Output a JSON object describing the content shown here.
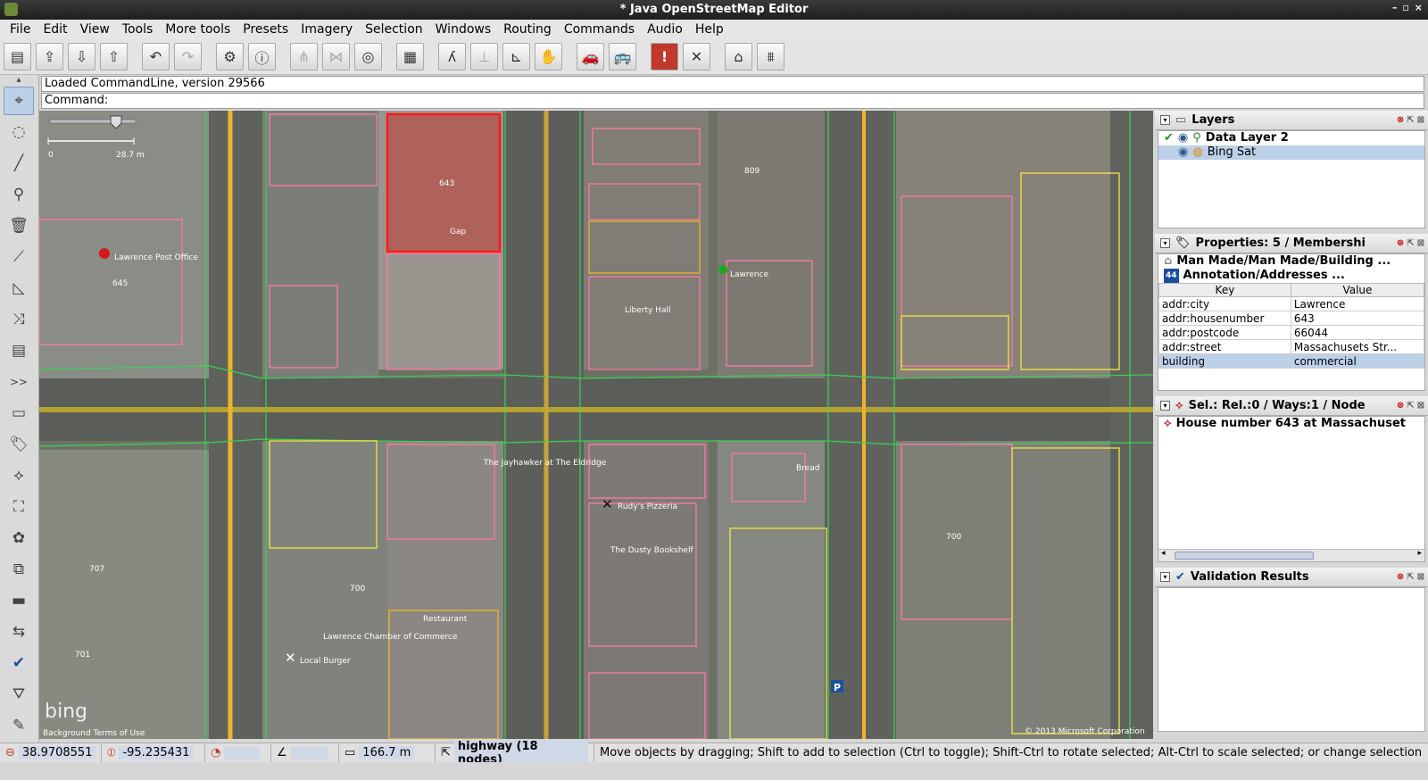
{
  "window": {
    "title": "* Java OpenStreetMap Editor",
    "controls": [
      "–",
      "▫",
      "×"
    ]
  },
  "menu": [
    "File",
    "Edit",
    "View",
    "Tools",
    "More tools",
    "Presets",
    "Imagery",
    "Selection",
    "Windows",
    "Routing",
    "Commands",
    "Audio",
    "Help"
  ],
  "toolbar": {
    "buttons": [
      {
        "name": "open-file",
        "glyph": "▤"
      },
      {
        "name": "save",
        "glyph": "⇪"
      },
      {
        "name": "download",
        "glyph": "⇩"
      },
      {
        "name": "upload",
        "glyph": "⇧"
      },
      {
        "name": "undo",
        "glyph": "↶"
      },
      {
        "name": "redo",
        "glyph": "↷"
      },
      {
        "name": "preferences",
        "glyph": "⚙"
      },
      {
        "name": "info",
        "glyph": "ⓘ"
      },
      {
        "name": "split-way",
        "glyph": "⋔"
      },
      {
        "name": "combine-way",
        "glyph": "⋈"
      },
      {
        "name": "validate",
        "glyph": "◎"
      },
      {
        "name": "wireframe",
        "glyph": "▦"
      },
      {
        "name": "lasso",
        "glyph": "ʎ"
      },
      {
        "name": "align",
        "glyph": "⊥"
      },
      {
        "name": "orthogonal",
        "glyph": "⊾"
      },
      {
        "name": "pan",
        "glyph": "✋"
      },
      {
        "name": "car-routing",
        "glyph": "🚗"
      },
      {
        "name": "bus-routing",
        "glyph": "🚌"
      },
      {
        "name": "warning",
        "glyph": "!"
      },
      {
        "name": "cross",
        "glyph": "✕"
      },
      {
        "name": "building-tool",
        "glyph": "⌂"
      },
      {
        "name": "factory",
        "glyph": "⩩"
      }
    ]
  },
  "console": {
    "line1": "Loaded CommandLine, version 29566",
    "line2": "Command:"
  },
  "map": {
    "scale_left": "0",
    "scale_right": "28.7 m",
    "labels": {
      "post_office": "Lawrence Post Office",
      "num645": "645",
      "gap": "Gap",
      "num643": "643",
      "liberty_hall": "Liberty Hall",
      "lawrence": "Lawrence",
      "num809": "809",
      "jayhawker": "The Jayhawker at The Eldridge",
      "rudys": "Rudy's Pizzeria",
      "dusty": "The Dusty Bookshelf",
      "bread": "Bread",
      "num700a": "700",
      "num700b": "700",
      "num707": "707",
      "num701": "701",
      "chamber": "Lawrence Chamber of Commerce",
      "local_burger": "Local Burger",
      "restaurant": "Restaurant",
      "bing": "bing",
      "bing_terms": "Background Terms of Use",
      "copyright": "© 2013 Microsoft Corporation",
      "parking": "P"
    }
  },
  "panels": {
    "layers": {
      "title": "Layers",
      "items": [
        {
          "name": "Data Layer 2",
          "selected": false
        },
        {
          "name": "Bing Sat",
          "selected": true
        }
      ]
    },
    "properties": {
      "title": "Properties: 5 / Membershi",
      "presets": [
        "Man Made/Man Made/Building ...",
        "Annotation/Addresses ..."
      ],
      "key_header": "Key",
      "value_header": "Value",
      "rows": [
        {
          "key": "addr:city",
          "value": "Lawrence"
        },
        {
          "key": "addr:housenumber",
          "value": "643"
        },
        {
          "key": "addr:postcode",
          "value": "66044"
        },
        {
          "key": "addr:street",
          "value": "Massachusets Str..."
        },
        {
          "key": "building",
          "value": "commercial"
        }
      ]
    },
    "selection": {
      "title": "Sel.: Rel.:0 / Ways:1 / Node",
      "item": "House number 643 at Massachuset"
    },
    "validation": {
      "title": "Validation Results"
    }
  },
  "status": {
    "lat": "38.9708551",
    "lon": "-95.235431",
    "heading": "",
    "angle": "",
    "distance": "166.7 m",
    "selection": "highway (18 nodes)",
    "message": "Move objects by dragging; Shift to add to selection (Ctrl to toggle); Shift-Ctrl to rotate selected; Alt-Ctrl to scale selected; or change selection"
  },
  "colors": {
    "selected_building": "#c0392b",
    "building_outline": "#ff7aa2",
    "highway": "#f0b429",
    "landuse": "#f5e642",
    "footway": "#39d353",
    "panel_selection": "#bcd0e8"
  }
}
